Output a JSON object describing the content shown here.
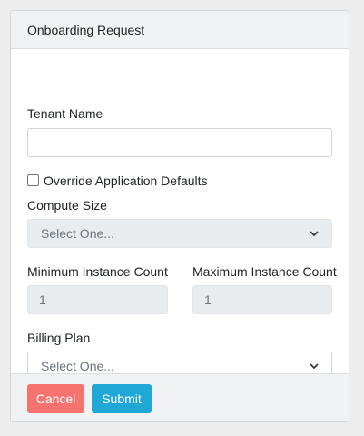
{
  "header": {
    "title": "Onboarding Request"
  },
  "form": {
    "tenant_name": {
      "label": "Tenant Name",
      "value": "",
      "placeholder": ""
    },
    "override_defaults": {
      "label": "Override Application Defaults",
      "checked": false
    },
    "compute_size": {
      "label": "Compute Size",
      "selected": "Select One..."
    },
    "min_instance_count": {
      "label": "Minimum Instance Count",
      "value": "1"
    },
    "max_instance_count": {
      "label": "Maximum Instance Count",
      "value": "1"
    },
    "billing_plan": {
      "label": "Billing Plan",
      "selected": "Select One..."
    }
  },
  "footer": {
    "cancel_label": "Cancel",
    "submit_label": "Submit"
  },
  "colors": {
    "cancel": "#f77370",
    "submit": "#1fa8d6",
    "header_bg": "#f1f2f4",
    "disabled_bg": "#e9ecef"
  },
  "icons": {
    "select_arrow": "chevron-down-icon"
  }
}
